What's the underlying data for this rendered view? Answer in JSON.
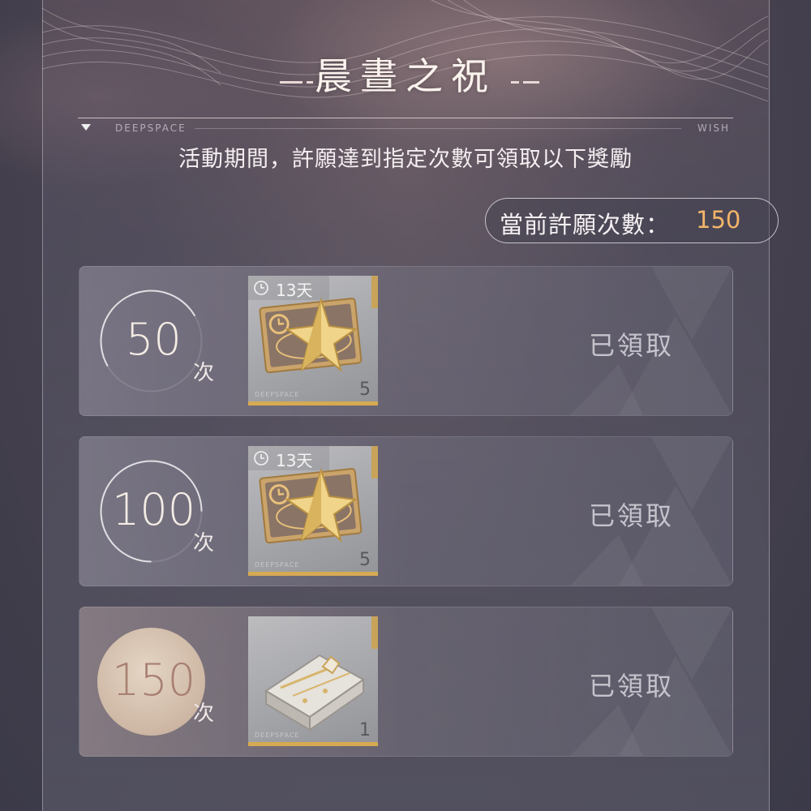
{
  "header": {
    "title": "晨晝之祝",
    "brand_left": "DEEPSPACE",
    "brand_right": "WISH",
    "subtitle": "活動期間，許願達到指定次數可領取以下獎勵"
  },
  "counter": {
    "label": "當前許願次數：",
    "value": "150"
  },
  "rewards": [
    {
      "milestone": "50",
      "unit": "次",
      "progress": 0.5,
      "item_icon": "star-ticket-icon",
      "timer": "13天",
      "quantity": "5",
      "watermark": "DEEPSPACE",
      "status": "已領取"
    },
    {
      "milestone": "100",
      "unit": "次",
      "progress": 0.75,
      "item_icon": "star-ticket-icon",
      "timer": "13天",
      "quantity": "5",
      "watermark": "DEEPSPACE",
      "status": "已領取"
    },
    {
      "milestone": "150",
      "unit": "次",
      "progress": 1.0,
      "item_icon": "gift-box-icon",
      "quantity": "1",
      "watermark": "DEEPSPACE",
      "status": "已領取"
    }
  ],
  "colors": {
    "accent": "#f3b56a",
    "item_border": "#d6aa52",
    "claimed_text": "#c5c3cb"
  }
}
